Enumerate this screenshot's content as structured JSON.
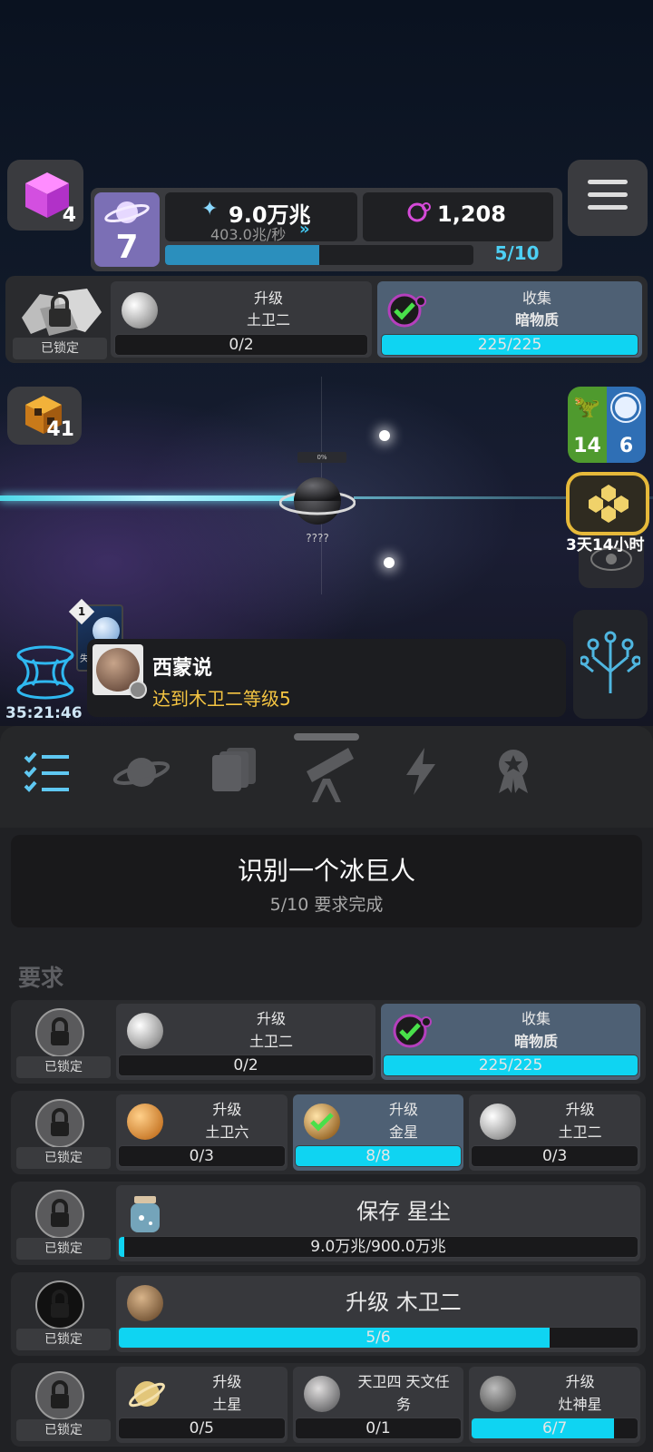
{
  "top": {
    "cube_count": "4",
    "level": "7",
    "stardust_amount": "9.0万兆",
    "stardust_rate": "403.0兆/秒",
    "dark_matter": "1,208",
    "progress_text": "5/10",
    "progress_fraction": 0.5
  },
  "top_req": {
    "locked_label": "已锁定",
    "item1_line1": "升级",
    "item1_line2": "土卫二",
    "item1_bar": "0/2",
    "item2_line1": "收集",
    "item2_line2": "暗物质",
    "item2_bar": "225/225"
  },
  "side": {
    "cube_count": "41",
    "dino_count": "14",
    "earth_count": "6",
    "timer_label": "3天14小时",
    "portal_timer": "35:21:46"
  },
  "planet": {
    "percent": "0%",
    "name": "????"
  },
  "notification": {
    "card_badge": "1",
    "card_caption": "失",
    "speaker": "西蒙说",
    "message": "达到木卫二等级5"
  },
  "tabs": [
    "missions-icon",
    "planet-icon",
    "cards-icon",
    "telescope-icon",
    "lightning-icon",
    "badge-icon"
  ],
  "mission": {
    "title": "识别一个冰巨人",
    "subtitle": "5/10 要求完成"
  },
  "requirements_header": "要求",
  "rows": [
    {
      "locked": "已锁定",
      "cells": [
        {
          "line1": "升级",
          "line2": "土卫二",
          "bar": "0/2",
          "fill": 0
        },
        {
          "line1": "收集",
          "line2": "暗物质",
          "bar": "225/225",
          "fill": 1
        }
      ]
    },
    {
      "locked": "已锁定",
      "cells": [
        {
          "line1": "升级",
          "line2": "土卫六",
          "bar": "0/3",
          "fill": 0
        },
        {
          "line1": "升级",
          "line2": "金星",
          "bar": "8/8",
          "fill": 1
        },
        {
          "line1": "升级",
          "line2": "土卫二",
          "bar": "0/3",
          "fill": 0
        }
      ]
    },
    {
      "locked": "已锁定",
      "cells": [
        {
          "line1": "保存 星尘",
          "bar": "9.0万兆/900.0万兆",
          "fill": 0.01
        }
      ]
    },
    {
      "locked": "已锁定",
      "cells": [
        {
          "line1": "升级 木卫二",
          "bar": "5/6",
          "fill": 0.83
        }
      ]
    },
    {
      "locked": "已锁定",
      "cells": [
        {
          "line1": "升级",
          "line2": "土星",
          "bar": "0/5",
          "fill": 0
        },
        {
          "line1": "天卫四 天文任",
          "line2": "务",
          "bar": "0/1",
          "fill": 0
        },
        {
          "line1": "升级",
          "line2": "灶神星",
          "bar": "6/7",
          "fill": 0.86
        }
      ]
    }
  ],
  "colors": {
    "accent": "#0fd4f2",
    "active_cell": "#4e6074",
    "notification_text": "#f5c542"
  }
}
